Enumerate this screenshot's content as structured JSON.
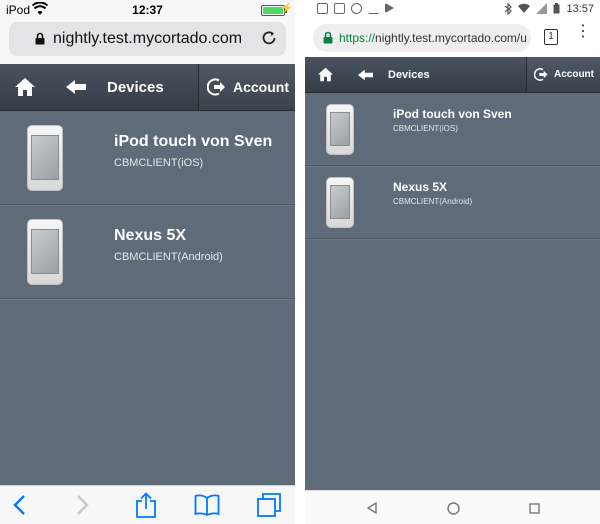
{
  "ios": {
    "status": {
      "carrier": "iPod",
      "time": "12:37"
    },
    "address": {
      "url": "nightly.test.mycortado.com"
    },
    "nav": {
      "title": "Devices",
      "account_label": "Account"
    },
    "devices": [
      {
        "name": "iPod touch von Sven",
        "client": "CBMCLIENT(iOS)"
      },
      {
        "name": "Nexus 5X",
        "client": "CBMCLIENT(Android)"
      }
    ]
  },
  "android": {
    "status": {
      "time": "13:57"
    },
    "address": {
      "scheme": "https://",
      "url": "nightly.test.mycortado.com/u"
    },
    "tab_count": "1",
    "nav": {
      "title": "Devices",
      "account_label": "Account"
    },
    "devices": [
      {
        "name": "iPod touch von Sven",
        "client": "CBMCLIENT(iOS)"
      },
      {
        "name": "Nexus 5X",
        "client": "CBMCLIENT(Android)"
      }
    ]
  },
  "colors": {
    "app_background": "#5f6b78",
    "navbar": "#3d4650",
    "ios_accent": "#007aff",
    "secure_green": "#0b8043"
  }
}
